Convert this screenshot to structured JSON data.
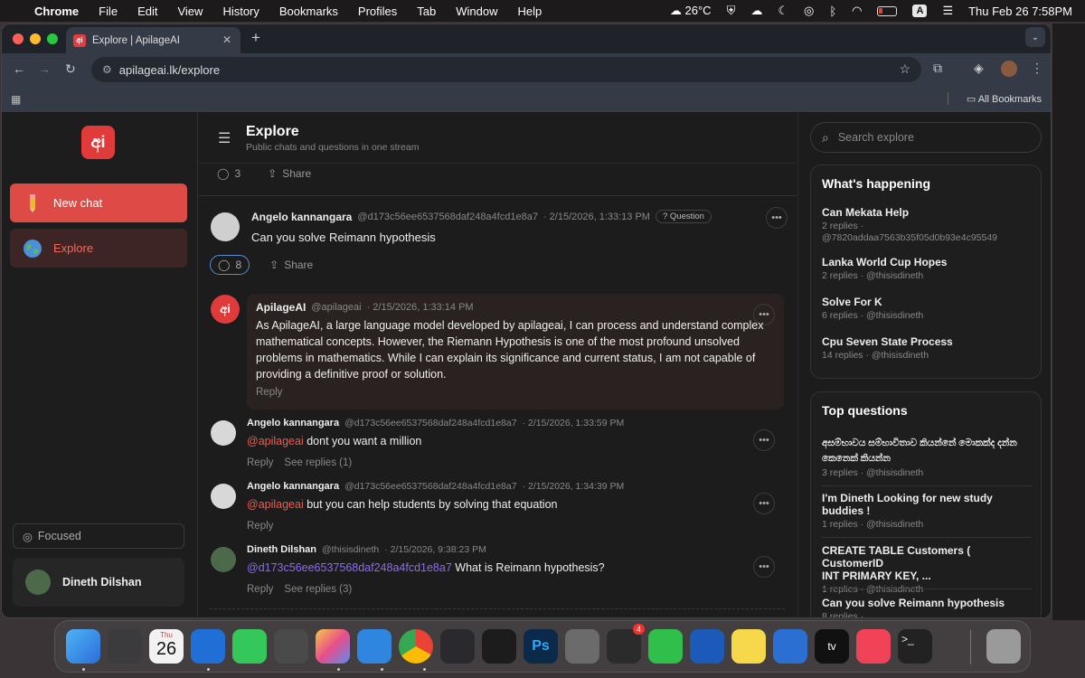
{
  "menubar": {
    "apple": "",
    "items": [
      "Chrome",
      "File",
      "Edit",
      "View",
      "History",
      "Bookmarks",
      "Profiles",
      "Tab",
      "Window",
      "Help"
    ],
    "weather": "26°C",
    "input_source": "A",
    "datetime": "Thu Feb 26  7:58PM"
  },
  "browser": {
    "tab_title": "Explore | ApilageAI",
    "favicon_text": "අi",
    "url": "apilageai.lk/explore",
    "all_bookmarks": "All Bookmarks"
  },
  "sidebar": {
    "logo_text": "අi",
    "new_chat": "New chat",
    "explore": "Explore",
    "focused": "Focused",
    "user_name": "Dineth Dilshan"
  },
  "main": {
    "title": "Explore",
    "subtitle": "Public chats and questions in one stream",
    "prev_post": {
      "comments": "3",
      "share": "Share"
    },
    "post": {
      "author": "Angelo kannangara",
      "handle": "@d173c56ee6537568daf248a4fcd1e8a7",
      "time": "· 2/15/2026, 1:33:13 PM",
      "badge": "Question",
      "text": "Can you solve Reimann hypothesis",
      "comments": "8",
      "share": "Share"
    },
    "ai_reply": {
      "author": "ApilageAI",
      "handle": "@apilageai",
      "time": "· 2/15/2026, 1:33:14 PM",
      "lines": [
        "As ApilageAI, a large language model developed by apilageai, I can process and understand complex",
        "mathematical concepts. However, the Riemann Hypothesis is one of the most profound unsolved",
        "problems in mathematics. While I can explain its significance and current status, I am not capable of",
        "providing a definitive proof or solution."
      ],
      "reply": "Reply"
    },
    "replies": [
      {
        "author": "Angelo kannangara",
        "handle": "@d173c56ee6537568daf248a4fcd1e8a7",
        "time": "· 2/15/2026, 1:33:59 PM",
        "mention": "@apilageai",
        "text": " dont you want a million",
        "reply": "Reply",
        "see": "See replies (1)"
      },
      {
        "author": "Angelo kannangara",
        "handle": "@d173c56ee6537568daf248a4fcd1e8a7",
        "time": "· 2/15/2026, 1:34:39 PM",
        "mention": "@apilageai",
        "text": " but you can help students by solving that equation",
        "reply": "Reply",
        "see": ""
      },
      {
        "author": "Dineth Dilshan",
        "handle": "@thisisdineth",
        "time": "· 2/15/2026, 9:38:23 PM",
        "mention": "@d173c56ee6537568daf248a4fcd1e8a7",
        "text": " What is Reimann hypothesis?",
        "reply": "Reply",
        "see": "See replies (3)"
      }
    ]
  },
  "right": {
    "search_placeholder": "Search explore",
    "happening_title": "What's happening",
    "happening": [
      {
        "title": "Can Mekata Help",
        "sub1": "2 replies ·",
        "sub2": "@7820addaa7563b35f05d0b93e4c95549"
      },
      {
        "title": "Lanka World Cup Hopes",
        "sub1": "2 replies · @thisisdineth",
        "sub2": ""
      },
      {
        "title": "Solve For K",
        "sub1": "6 replies · @thisisdineth",
        "sub2": ""
      },
      {
        "title": "Cpu Seven State Process",
        "sub1": "14 replies · @thisisdineth",
        "sub2": ""
      }
    ],
    "top_title": "Top questions",
    "top": [
      {
        "l1": "අසම්භාවය සම්භාවිතාව කියන්නේ මොකක්ද දන්න",
        "l2": "කෙනෙක් කියන්න",
        "sub": "3 replies · @thisisdineth"
      },
      {
        "l1": "I'm Dineth Looking for new study",
        "l2": "buddies !",
        "sub": "1 replies · @thisisdineth"
      },
      {
        "l1": "CREATE TABLE Customers ( CustomerID",
        "l2": "INT PRIMARY KEY, ...",
        "sub": "1 replies · @thisisdineth"
      },
      {
        "l1": "Can you solve Reimann hypothesis",
        "l2": "",
        "sub": "8 replies ·"
      }
    ]
  },
  "dock": {
    "calendar_day": "Thu",
    "calendar_date": "26",
    "badge": "4"
  }
}
